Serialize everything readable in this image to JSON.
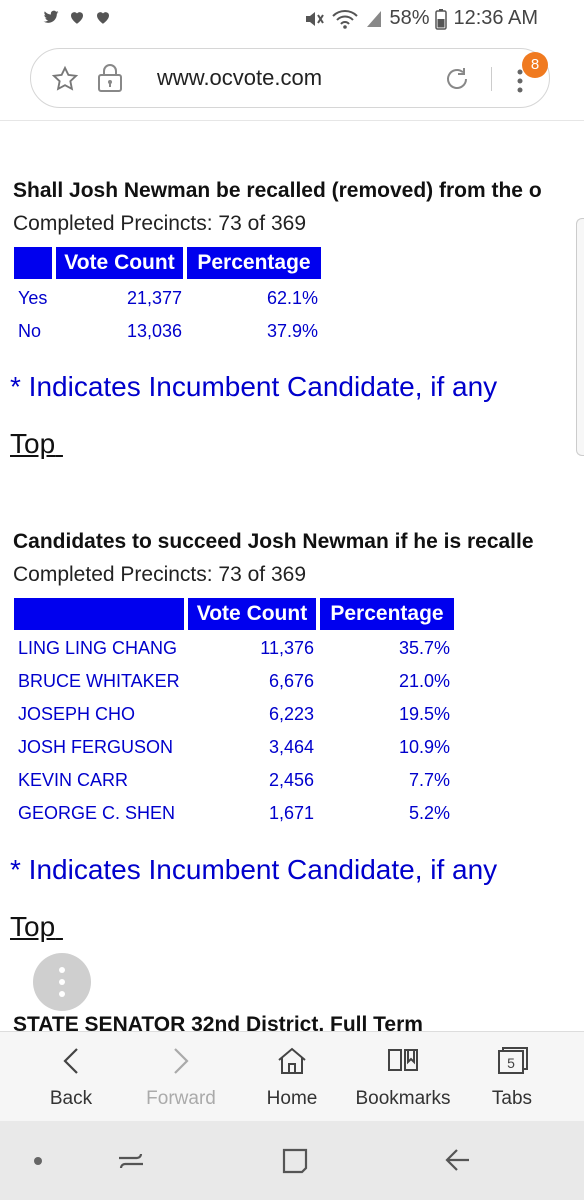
{
  "status_bar": {
    "battery": "58%",
    "time": "12:36 AM",
    "icons": [
      "twitter-icon",
      "heart-icon",
      "heart-icon",
      "mute-icon",
      "wifi-icon",
      "signal-icon",
      "battery-icon"
    ]
  },
  "browser": {
    "url": "www.ocvote.com",
    "notification_count": "8"
  },
  "sections": [
    {
      "title": "Shall Josh Newman be recalled (removed) from the o",
      "precincts": "Completed Precincts: 73 of 369",
      "columns": [
        "",
        "Vote Count",
        "Percentage"
      ],
      "rows": [
        {
          "name": "Yes",
          "votes": "21,377",
          "pct": "62.1%"
        },
        {
          "name": "No",
          "votes": "13,036",
          "pct": "37.9%"
        }
      ],
      "incumbent_note": "* Indicates Incumbent Candidate, if any",
      "top_link": "Top"
    },
    {
      "title": "Candidates to succeed Josh Newman if he is recalle",
      "precincts": "Completed Precincts: 73 of 369",
      "columns": [
        "",
        "Vote Count",
        "Percentage"
      ],
      "rows": [
        {
          "name": "LING LING CHANG",
          "votes": "11,376",
          "pct": "35.7%"
        },
        {
          "name": "BRUCE WHITAKER",
          "votes": "6,676",
          "pct": "21.0%"
        },
        {
          "name": "JOSEPH CHO",
          "votes": "6,223",
          "pct": "19.5%"
        },
        {
          "name": "JOSH FERGUSON",
          "votes": "3,464",
          "pct": "10.9%"
        },
        {
          "name": "KEVIN CARR",
          "votes": "2,456",
          "pct": "7.7%"
        },
        {
          "name": "GEORGE C. SHEN",
          "votes": "1,671",
          "pct": "5.2%"
        }
      ],
      "incumbent_note": "* Indicates Incumbent Candidate, if any",
      "top_link": "Top"
    },
    {
      "title": "STATE SENATOR 32nd District, Full Term"
    }
  ],
  "bottom_nav": {
    "back": "Back",
    "forward": "Forward",
    "home": "Home",
    "bookmarks": "Bookmarks",
    "tabs": "Tabs",
    "tabs_count": "5"
  },
  "colors": {
    "header_blue": "#0000ee",
    "link_blue": "#0000cc",
    "badge_orange": "#f07a20"
  }
}
